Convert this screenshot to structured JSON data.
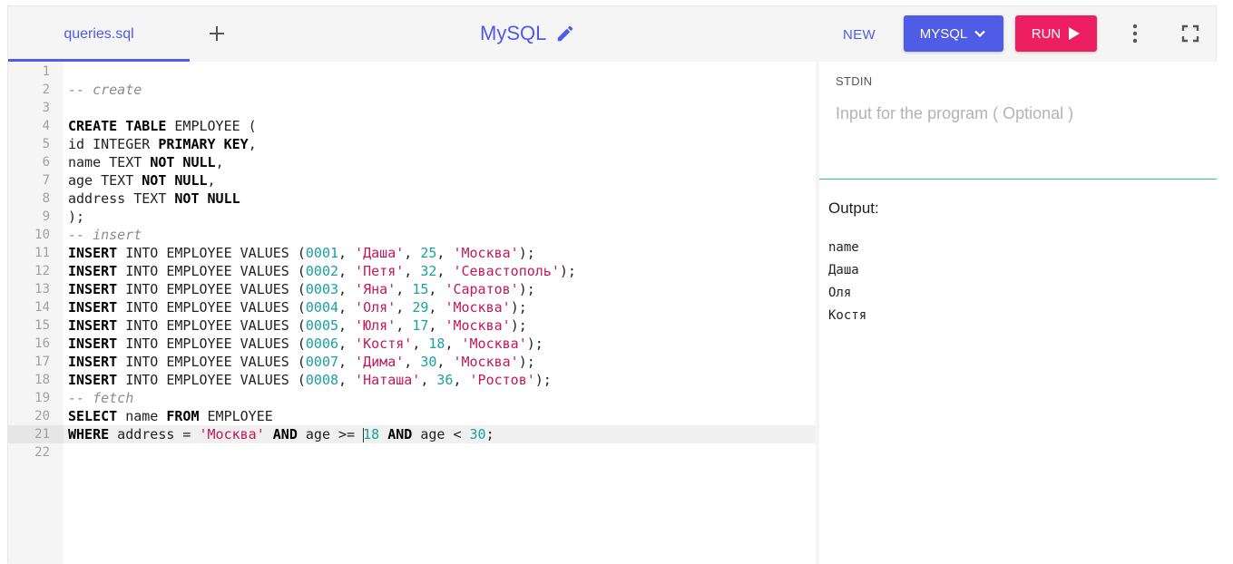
{
  "toolbar": {
    "tab_name": "queries.sql",
    "title": "MySQL",
    "new_label": "NEW",
    "language_label": "MYSQL",
    "run_label": "RUN"
  },
  "stdin": {
    "label": "STDIN",
    "placeholder": "Input for the program ( Optional )"
  },
  "output": {
    "label": "Output:",
    "lines": [
      "name",
      "Даша",
      "Оля",
      "Костя"
    ]
  },
  "editor": {
    "active_line": 21,
    "lines": [
      [],
      [
        [
          "cm",
          "-- create"
        ]
      ],
      [],
      [
        [
          "kw",
          "CREATE"
        ],
        [
          "t",
          " "
        ],
        [
          "kw",
          "TABLE"
        ],
        [
          "t",
          " EMPLOYEE ("
        ]
      ],
      [
        [
          "t",
          "id INTEGER "
        ],
        [
          "kw",
          "PRIMARY KEY"
        ],
        [
          "t",
          ","
        ]
      ],
      [
        [
          "t",
          "name TEXT "
        ],
        [
          "kw",
          "NOT NULL"
        ],
        [
          "t",
          ","
        ]
      ],
      [
        [
          "t",
          "age TEXT "
        ],
        [
          "kw",
          "NOT NULL"
        ],
        [
          "t",
          ","
        ]
      ],
      [
        [
          "t",
          "address TEXT "
        ],
        [
          "kw",
          "NOT NULL"
        ]
      ],
      [
        [
          "t",
          ");"
        ]
      ],
      [
        [
          "cm",
          "-- insert"
        ]
      ],
      [
        [
          "kw",
          "INSERT"
        ],
        [
          "t",
          " INTO EMPLOYEE VALUES ("
        ],
        [
          "num",
          "0001"
        ],
        [
          "t",
          ", "
        ],
        [
          "str",
          "'Даша'"
        ],
        [
          "t",
          ", "
        ],
        [
          "num",
          "25"
        ],
        [
          "t",
          ", "
        ],
        [
          "str",
          "'Москва'"
        ],
        [
          "t",
          ");"
        ]
      ],
      [
        [
          "kw",
          "INSERT"
        ],
        [
          "t",
          " INTO EMPLOYEE VALUES ("
        ],
        [
          "num",
          "0002"
        ],
        [
          "t",
          ", "
        ],
        [
          "str",
          "'Петя'"
        ],
        [
          "t",
          ", "
        ],
        [
          "num",
          "32"
        ],
        [
          "t",
          ", "
        ],
        [
          "str",
          "'Севастополь'"
        ],
        [
          "t",
          ");"
        ]
      ],
      [
        [
          "kw",
          "INSERT"
        ],
        [
          "t",
          " INTO EMPLOYEE VALUES ("
        ],
        [
          "num",
          "0003"
        ],
        [
          "t",
          ", "
        ],
        [
          "str",
          "'Яна'"
        ],
        [
          "t",
          ", "
        ],
        [
          "num",
          "15"
        ],
        [
          "t",
          ", "
        ],
        [
          "str",
          "'Саратов'"
        ],
        [
          "t",
          ");"
        ]
      ],
      [
        [
          "kw",
          "INSERT"
        ],
        [
          "t",
          " INTO EMPLOYEE VALUES ("
        ],
        [
          "num",
          "0004"
        ],
        [
          "t",
          ", "
        ],
        [
          "str",
          "'Оля'"
        ],
        [
          "t",
          ", "
        ],
        [
          "num",
          "29"
        ],
        [
          "t",
          ", "
        ],
        [
          "str",
          "'Москва'"
        ],
        [
          "t",
          ");"
        ]
      ],
      [
        [
          "kw",
          "INSERT"
        ],
        [
          "t",
          " INTO EMPLOYEE VALUES ("
        ],
        [
          "num",
          "0005"
        ],
        [
          "t",
          ", "
        ],
        [
          "str",
          "'Юля'"
        ],
        [
          "t",
          ", "
        ],
        [
          "num",
          "17"
        ],
        [
          "t",
          ", "
        ],
        [
          "str",
          "'Москва'"
        ],
        [
          "t",
          ");"
        ]
      ],
      [
        [
          "kw",
          "INSERT"
        ],
        [
          "t",
          " INTO EMPLOYEE VALUES ("
        ],
        [
          "num",
          "0006"
        ],
        [
          "t",
          ", "
        ],
        [
          "str",
          "'Костя'"
        ],
        [
          "t",
          ", "
        ],
        [
          "num",
          "18"
        ],
        [
          "t",
          ", "
        ],
        [
          "str",
          "'Москва'"
        ],
        [
          "t",
          ");"
        ]
      ],
      [
        [
          "kw",
          "INSERT"
        ],
        [
          "t",
          " INTO EMPLOYEE VALUES ("
        ],
        [
          "num",
          "0007"
        ],
        [
          "t",
          ", "
        ],
        [
          "str",
          "'Дима'"
        ],
        [
          "t",
          ", "
        ],
        [
          "num",
          "30"
        ],
        [
          "t",
          ", "
        ],
        [
          "str",
          "'Москва'"
        ],
        [
          "t",
          ");"
        ]
      ],
      [
        [
          "kw",
          "INSERT"
        ],
        [
          "t",
          " INTO EMPLOYEE VALUES ("
        ],
        [
          "num",
          "0008"
        ],
        [
          "t",
          ", "
        ],
        [
          "str",
          "'Наташа'"
        ],
        [
          "t",
          ", "
        ],
        [
          "num",
          "36"
        ],
        [
          "t",
          ", "
        ],
        [
          "str",
          "'Ростов'"
        ],
        [
          "t",
          ");"
        ]
      ],
      [
        [
          "cm",
          "-- fetch"
        ]
      ],
      [
        [
          "kw",
          "SELECT"
        ],
        [
          "t",
          " name "
        ],
        [
          "kw",
          "FROM"
        ],
        [
          "t",
          " EMPLOYEE"
        ]
      ],
      [
        [
          "kw",
          "WHERE"
        ],
        [
          "t",
          " address = "
        ],
        [
          "str",
          "'Москва'"
        ],
        [
          "t",
          " "
        ],
        [
          "kw",
          "AND"
        ],
        [
          "t",
          " age >= "
        ],
        [
          "cursor",
          ""
        ],
        [
          "num",
          "18"
        ],
        [
          "t",
          " "
        ],
        [
          "kw",
          "AND"
        ],
        [
          "t",
          " age < "
        ],
        [
          "num",
          "30"
        ],
        [
          "t",
          ";"
        ]
      ],
      []
    ]
  },
  "colors": {
    "accent": "#4e5ce6",
    "run": "#ed1e62",
    "divider": "#2ecc71"
  },
  "icons": {
    "add_tab": "plus-icon",
    "edit_title": "pencil-icon",
    "language_dropdown": "chevron-down-icon",
    "run": "play-icon",
    "more": "more-vert-icon",
    "fullscreen": "fullscreen-icon"
  }
}
